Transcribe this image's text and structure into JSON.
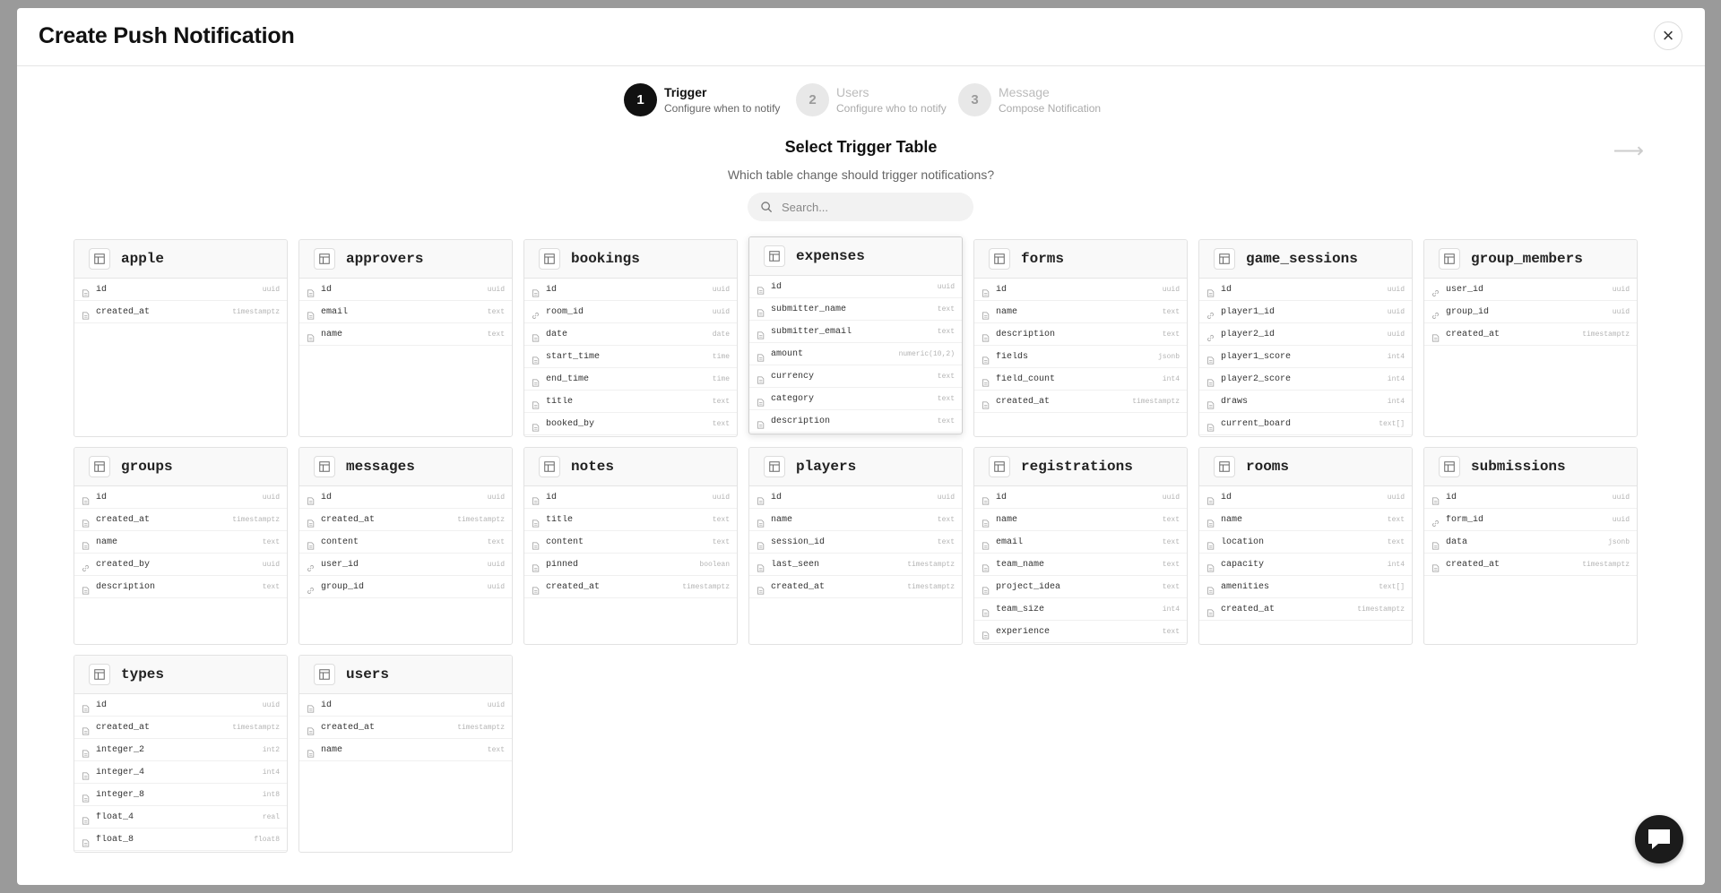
{
  "modal": {
    "title": "Create Push Notification",
    "close_label": "×"
  },
  "steps": [
    {
      "number": "1",
      "title": "Trigger",
      "subtitle": "Configure when to notify"
    },
    {
      "number": "2",
      "title": "Users",
      "subtitle": "Configure who to notify"
    },
    {
      "number": "3",
      "title": "Message",
      "subtitle": "Compose Notification"
    }
  ],
  "selector": {
    "title": "Select Trigger Table",
    "subtitle": "Which table change should trigger notifications?",
    "search_placeholder": "Search...",
    "next_arrow": "⟶"
  },
  "tables": [
    {
      "name": "apple",
      "columns": [
        [
          "id",
          "uuid",
          "field"
        ],
        [
          "created_at",
          "timestamptz",
          "field"
        ]
      ]
    },
    {
      "name": "approvers",
      "columns": [
        [
          "id",
          "uuid",
          "field"
        ],
        [
          "email",
          "text",
          "field"
        ],
        [
          "name",
          "text",
          "field"
        ]
      ]
    },
    {
      "name": "bookings",
      "columns": [
        [
          "id",
          "uuid",
          "field"
        ],
        [
          "room_id",
          "uuid",
          "link"
        ],
        [
          "date",
          "date",
          "field"
        ],
        [
          "start_time",
          "time",
          "field"
        ],
        [
          "end_time",
          "time",
          "field"
        ],
        [
          "title",
          "text",
          "field"
        ],
        [
          "booked_by",
          "text",
          "field"
        ]
      ]
    },
    {
      "name": "expenses",
      "columns": [
        [
          "id",
          "uuid",
          "field"
        ],
        [
          "submitter_name",
          "text",
          "field"
        ],
        [
          "submitter_email",
          "text",
          "field"
        ],
        [
          "amount",
          "numeric(10,2)",
          "field"
        ],
        [
          "currency",
          "text",
          "field"
        ],
        [
          "category",
          "text",
          "field"
        ],
        [
          "description",
          "text",
          "field"
        ]
      ]
    },
    {
      "name": "forms",
      "columns": [
        [
          "id",
          "uuid",
          "field"
        ],
        [
          "name",
          "text",
          "field"
        ],
        [
          "description",
          "text",
          "field"
        ],
        [
          "fields",
          "jsonb",
          "field"
        ],
        [
          "field_count",
          "int4",
          "field"
        ],
        [
          "created_at",
          "timestamptz",
          "field"
        ]
      ]
    },
    {
      "name": "game_sessions",
      "columns": [
        [
          "id",
          "uuid",
          "field"
        ],
        [
          "player1_id",
          "uuid",
          "link"
        ],
        [
          "player2_id",
          "uuid",
          "link"
        ],
        [
          "player1_score",
          "int4",
          "field"
        ],
        [
          "player2_score",
          "int4",
          "field"
        ],
        [
          "draws",
          "int4",
          "field"
        ],
        [
          "current_board",
          "text[]",
          "field"
        ]
      ]
    },
    {
      "name": "group_members",
      "columns": [
        [
          "user_id",
          "uuid",
          "link"
        ],
        [
          "group_id",
          "uuid",
          "link"
        ],
        [
          "created_at",
          "timestamptz",
          "field"
        ]
      ]
    },
    {
      "name": "groups",
      "columns": [
        [
          "id",
          "uuid",
          "field"
        ],
        [
          "created_at",
          "timestamptz",
          "field"
        ],
        [
          "name",
          "text",
          "field"
        ],
        [
          "created_by",
          "uuid",
          "link"
        ],
        [
          "description",
          "text",
          "field"
        ]
      ]
    },
    {
      "name": "messages",
      "columns": [
        [
          "id",
          "uuid",
          "field"
        ],
        [
          "created_at",
          "timestamptz",
          "field"
        ],
        [
          "content",
          "text",
          "field"
        ],
        [
          "user_id",
          "uuid",
          "link"
        ],
        [
          "group_id",
          "uuid",
          "link"
        ]
      ]
    },
    {
      "name": "notes",
      "columns": [
        [
          "id",
          "uuid",
          "field"
        ],
        [
          "title",
          "text",
          "field"
        ],
        [
          "content",
          "text",
          "field"
        ],
        [
          "pinned",
          "boolean",
          "field"
        ],
        [
          "created_at",
          "timestamptz",
          "field"
        ]
      ]
    },
    {
      "name": "players",
      "columns": [
        [
          "id",
          "uuid",
          "field"
        ],
        [
          "name",
          "text",
          "field"
        ],
        [
          "session_id",
          "text",
          "field"
        ],
        [
          "last_seen",
          "timestamptz",
          "field"
        ],
        [
          "created_at",
          "timestamptz",
          "field"
        ]
      ]
    },
    {
      "name": "registrations",
      "columns": [
        [
          "id",
          "uuid",
          "field"
        ],
        [
          "name",
          "text",
          "field"
        ],
        [
          "email",
          "text",
          "field"
        ],
        [
          "team_name",
          "text",
          "field"
        ],
        [
          "project_idea",
          "text",
          "field"
        ],
        [
          "team_size",
          "int4",
          "field"
        ],
        [
          "experience",
          "text",
          "field"
        ]
      ]
    },
    {
      "name": "rooms",
      "columns": [
        [
          "id",
          "uuid",
          "field"
        ],
        [
          "name",
          "text",
          "field"
        ],
        [
          "location",
          "text",
          "field"
        ],
        [
          "capacity",
          "int4",
          "field"
        ],
        [
          "amenities",
          "text[]",
          "field"
        ],
        [
          "created_at",
          "timestamptz",
          "field"
        ]
      ]
    },
    {
      "name": "submissions",
      "columns": [
        [
          "id",
          "uuid",
          "field"
        ],
        [
          "form_id",
          "uuid",
          "link"
        ],
        [
          "data",
          "jsonb",
          "field"
        ],
        [
          "created_at",
          "timestamptz",
          "field"
        ]
      ]
    },
    {
      "name": "types",
      "columns": [
        [
          "id",
          "uuid",
          "field"
        ],
        [
          "created_at",
          "timestamptz",
          "field"
        ],
        [
          "integer_2",
          "int2",
          "field"
        ],
        [
          "integer_4",
          "int4",
          "field"
        ],
        [
          "integer_8",
          "int8",
          "field"
        ],
        [
          "float_4",
          "real",
          "field"
        ],
        [
          "float_8",
          "float8",
          "field"
        ]
      ]
    },
    {
      "name": "users",
      "columns": [
        [
          "id",
          "uuid",
          "field"
        ],
        [
          "created_at",
          "timestamptz",
          "field"
        ],
        [
          "name",
          "text",
          "field"
        ]
      ]
    }
  ],
  "colors": {
    "accent": "#111111",
    "card_border": "#e2e2e2",
    "type_text": "#b4b4b4"
  }
}
